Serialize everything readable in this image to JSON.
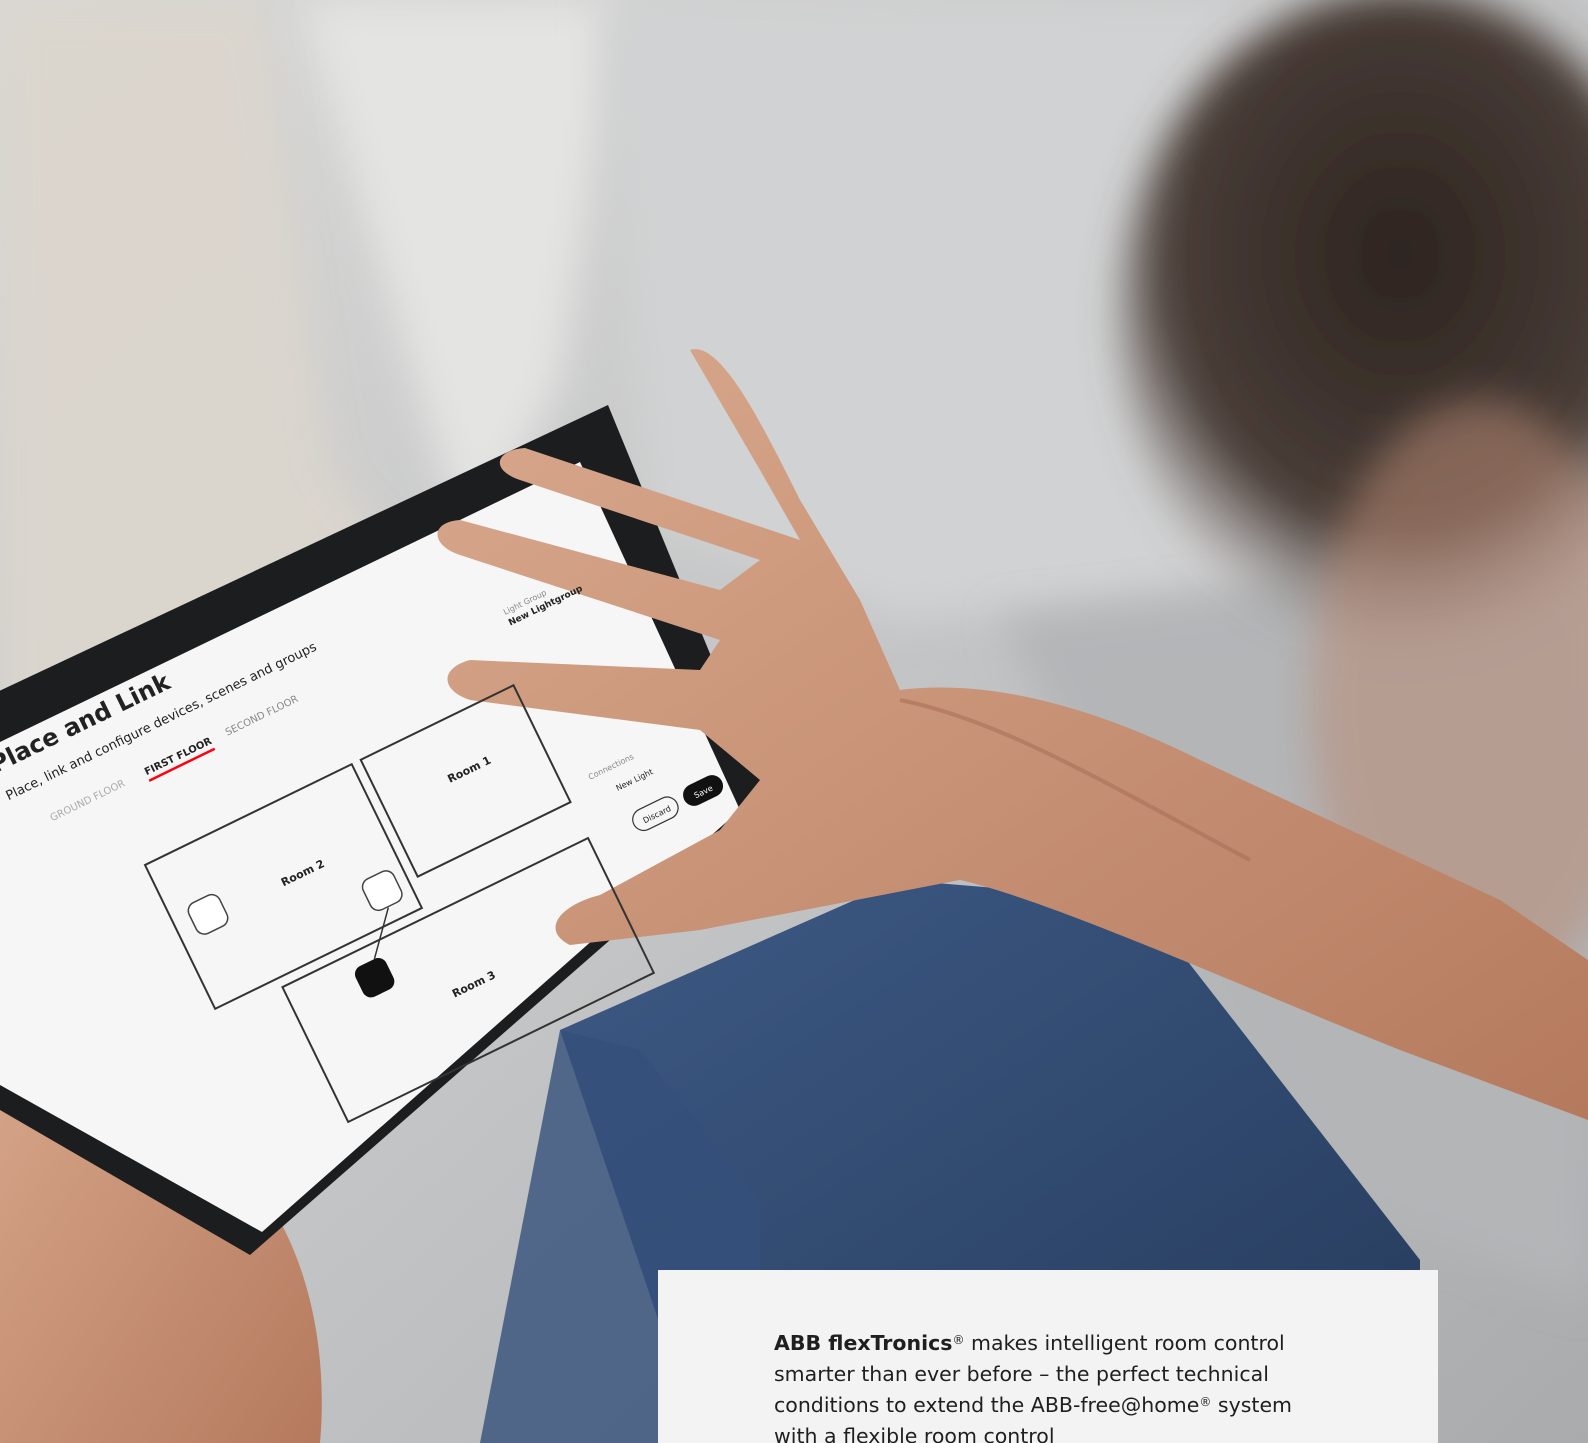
{
  "tablet_app": {
    "title": "Place and Link",
    "subtitle": "Place, link and configure devices, scenes and groups",
    "tabs": [
      {
        "label": "GROUND FLOOR",
        "active": false
      },
      {
        "label": "FIRST FLOOR",
        "active": true
      },
      {
        "label": "SECOND FLOOR",
        "active": false
      }
    ],
    "rooms": [
      {
        "name": "Room 1"
      },
      {
        "name": "Room 2"
      },
      {
        "name": "Room 3"
      }
    ],
    "panel": {
      "field_label": "Light Group",
      "field_value": "New Lightgroup",
      "connections_label": "Connections",
      "connection_item": "New Light",
      "discard_label": "Discard",
      "save_label": "Save"
    }
  },
  "caption": {
    "brand": "ABB flexTronics",
    "brand_mark": "®",
    "text_1": " makes intelligent room control smarter than ever before – the perfect technical conditions to extend the ABB-free@",
    "text_2": "home",
    "text_mark": "®",
    "text_3": " system with a flexible room control"
  },
  "colors": {
    "accent": "#ff000f",
    "ui_background": "#f6f6f6",
    "caption_background": "#f3f3f3"
  }
}
